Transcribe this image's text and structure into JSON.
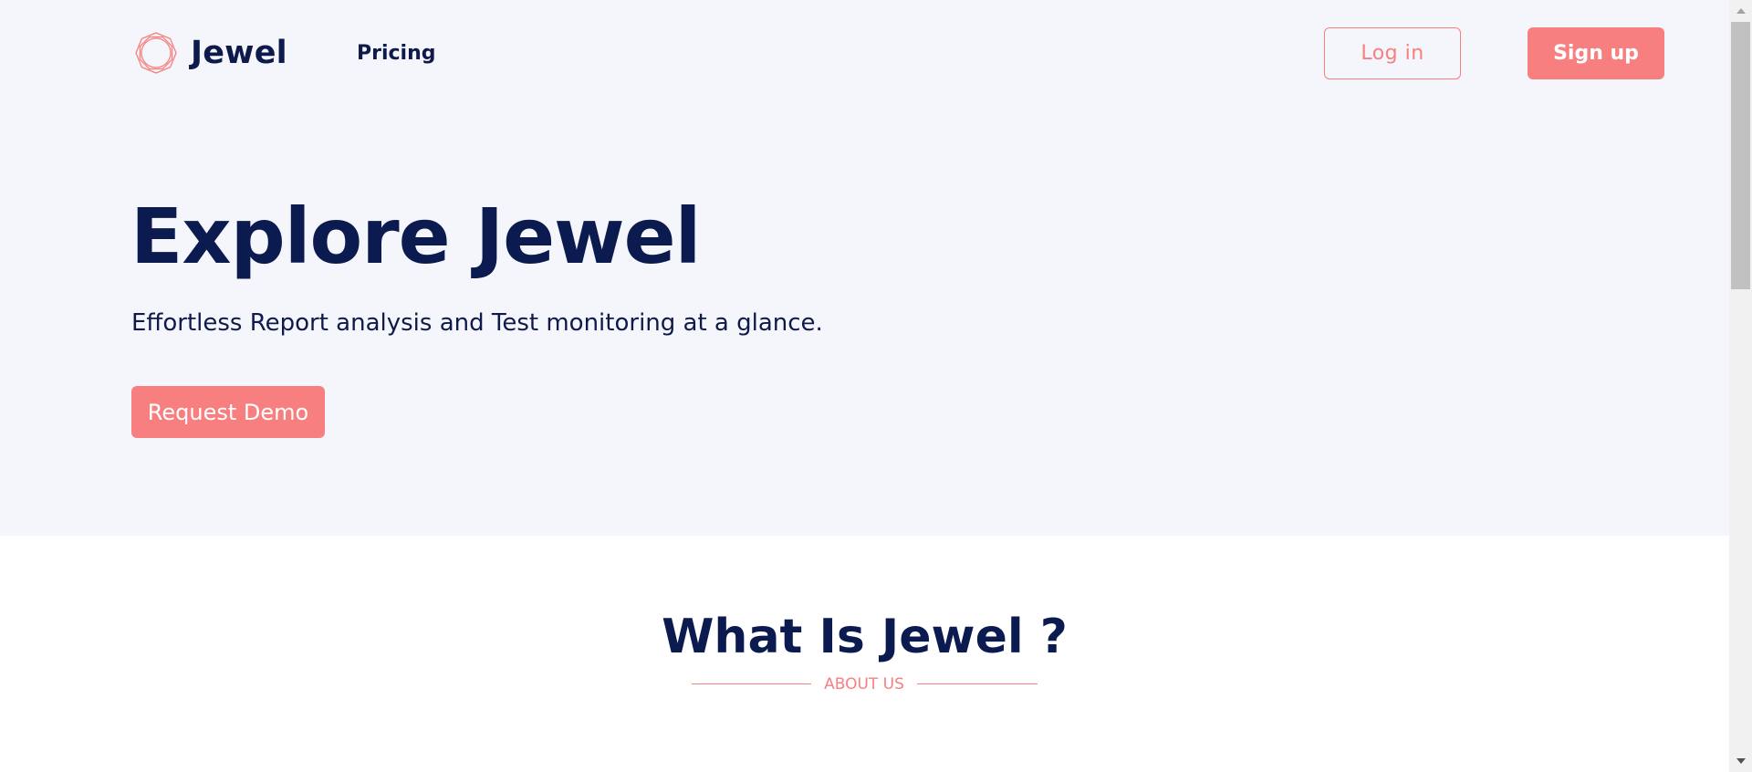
{
  "nav": {
    "brand": "Jewel",
    "links": [
      {
        "label": "Pricing"
      }
    ],
    "login_label": "Log in",
    "signup_label": "Sign up"
  },
  "hero": {
    "title": "Explore Jewel",
    "subtitle": "Effortless Report analysis and Test monitoring at a glance.",
    "cta_label": "Request Demo"
  },
  "about": {
    "title": "What Is Jewel ?",
    "label": "ABOUT US"
  },
  "colors": {
    "accent": "#f87f7f",
    "navy": "#0b1a4f",
    "hero_background": "#f5f6fb"
  },
  "icons": {
    "logo": "gem-outline-icon",
    "scroll_up": "triangle-up-icon",
    "scroll_down": "triangle-down-icon"
  },
  "scrollbar": {
    "position_fraction": 0
  }
}
